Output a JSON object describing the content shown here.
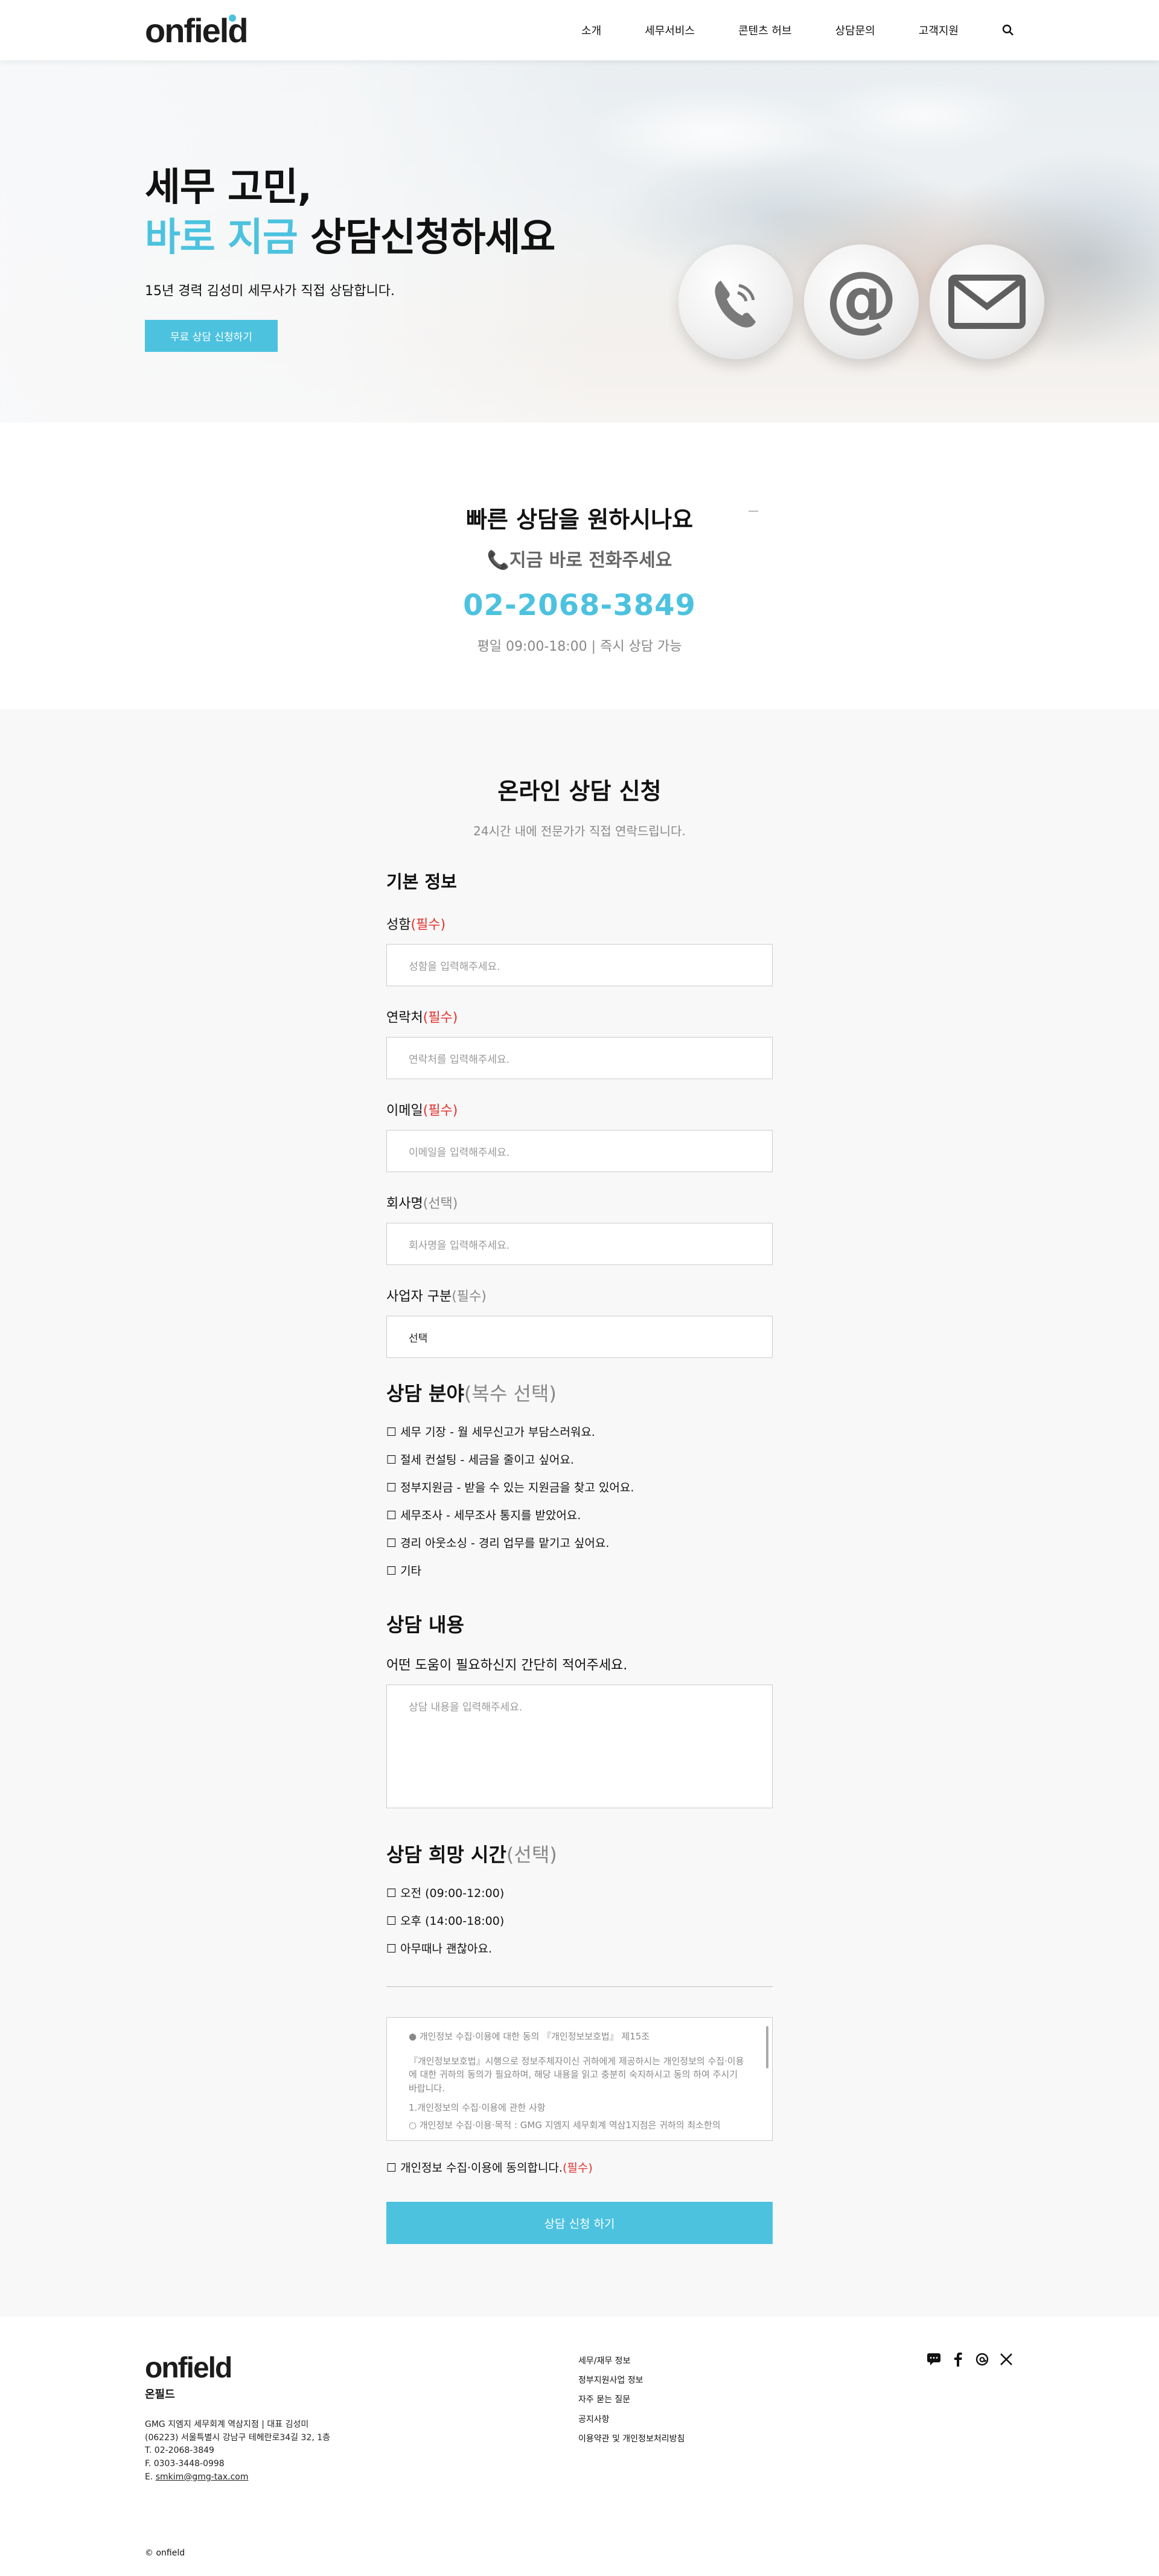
{
  "header": {
    "logo": "onfield",
    "nav": [
      "소개",
      "세무서비스",
      "콘텐츠 허브",
      "상담문의",
      "고객지원"
    ]
  },
  "hero": {
    "line1": "세무 고민,",
    "accent": "바로 지금",
    "line2_rest": " 상담신청하세요",
    "desc": "15년 경력 김성미 세무사가 직접 상담합니다.",
    "cta": "무료 상담 신청하기"
  },
  "quick": {
    "title": "빠른 상담을 원하시나요",
    "subtitle": "지금 바로 전화주세요",
    "phone": "02-2068-3849",
    "hours": "평일 09:00-18:00 | 즉시 상담 가능"
  },
  "form": {
    "title": "온라인 상담 신청",
    "subtitle": "24시간 내에 전문가가 직접 연락드립니다.",
    "basic_heading": "기본 정보",
    "fields": [
      {
        "label": "성함",
        "tag": "(필수)",
        "placeholder": "성함을 입력해주세요."
      },
      {
        "label": "연락처",
        "tag": "(필수)",
        "placeholder": "연락처를 입력해주세요."
      },
      {
        "label": "이메일",
        "tag": "(필수)",
        "placeholder": "이메일을 입력해주세요."
      },
      {
        "label": "회사명",
        "tag": "(선택)",
        "placeholder": "회사명을 입력해주세요."
      }
    ],
    "biz": {
      "label": "사업자 구분",
      "tag": "(필수)",
      "selected": "선택"
    },
    "field_heading": "상담 분야",
    "field_heading_tag": "(복수 선택)",
    "fields_checks": [
      "☐ 세무 기장 - 월 세무신고가 부담스러워요.",
      "☐ 절세 컨설팅 - 세금을 줄이고 싶어요.",
      "☐  정부지원금 - 받을 수 있는 지원금을 찾고 있어요.",
      "☐  세무조사 - 세무조사 통지를 받았어요.",
      "☐  경리 아웃소싱 - 경리 업무를 맡기고 싶어요.",
      "☐ 기타"
    ],
    "content_heading": "상담 내용",
    "content_label": "어떤 도움이 필요하신지 간단히 적어주세요.",
    "content_placeholder": "상담 내용을 입력해주세요.",
    "time_heading": "상담 희망 시간",
    "time_heading_tag": "(선택)",
    "time_checks": [
      "☐ 오전 (09:00-12:00)",
      "☐ 오후 (14:00-18:00)",
      "☐  아무때나 괜찮아요."
    ],
    "privacy": [
      "● 개인정보 수집·이용에 대한 동의 『개인정보보호법』 제15조",
      "『개인정보보호법』시행으로 정보주체자이신 귀하에게 제공하시는 개인정보의 수집·이용에 대한 귀하의 동의가 필요하며, 해당 내용을 읽고 충분히 숙지하시고 동의 하여 주시기 바랍니다.",
      "1.개인정보의 수집·이용에 관한 사항",
      "○ 개인정보 수집·이용·목적 : GMG 지엠지 세무회계 역삼1지점은 귀하의 최소한의"
    ],
    "agree": "☐ 개인정보 수집·이용에 동의합니다.",
    "agree_tag": "(필수)",
    "submit": "상담 신청 하기"
  },
  "footer": {
    "logo": "onfield",
    "kor": "온필드",
    "info": [
      "GMG 지엠지 세무회계 역삼지점 | 대표 김성미",
      "(06223) 서울특별시 강남구 테헤란로34길 32, 1층",
      "T. 02-2068-3849",
      "F. 0303-3448-0998"
    ],
    "email_prefix": "E. ",
    "email": "smkim@gmg-tax.com",
    "links": [
      "세무/재무 정보",
      "정부지원사업 정보",
      "자주 묻는 질문",
      "공지사항",
      "이용약관 및 개인정보처리방침"
    ],
    "copyright": "© onfield"
  },
  "colors": {
    "accent": "#4cc2df",
    "required": "#e3312c"
  }
}
